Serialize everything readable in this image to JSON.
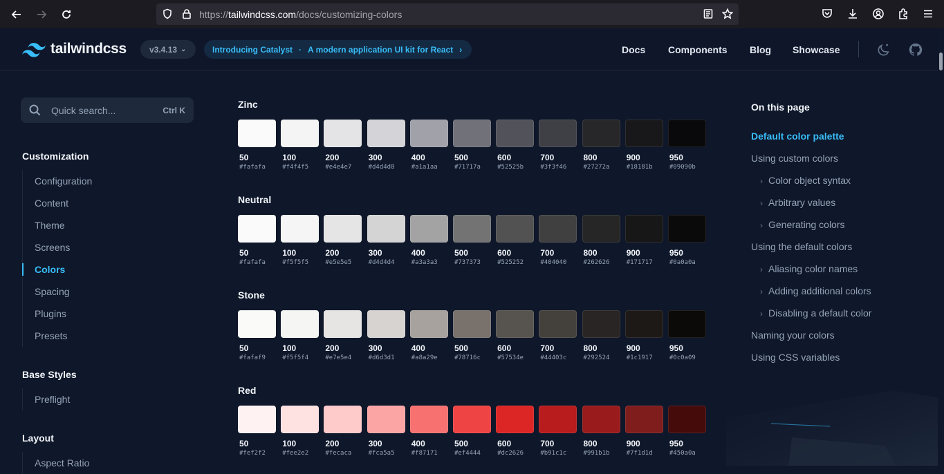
{
  "browser": {
    "url_prefix": "https://",
    "url_host": "tailwindcss.com",
    "url_path": "/docs/customizing-colors"
  },
  "header": {
    "logo_text": "tailwindcss",
    "version": "v3.4.13",
    "promo_title": "Introducing Catalyst",
    "promo_dot": "·",
    "promo_subtitle": "A modern application UI kit for React",
    "promo_arrow": "›",
    "nav": [
      "Docs",
      "Components",
      "Blog",
      "Showcase"
    ]
  },
  "sidebar": {
    "search_placeholder": "Quick search...",
    "search_shortcut": "Ctrl K",
    "sections": [
      {
        "title": "Customization",
        "items": [
          "Configuration",
          "Content",
          "Theme",
          "Screens",
          "Colors",
          "Spacing",
          "Plugins",
          "Presets"
        ],
        "active": "Colors"
      },
      {
        "title": "Base Styles",
        "items": [
          "Preflight"
        ]
      },
      {
        "title": "Layout",
        "items": [
          "Aspect Ratio"
        ]
      }
    ]
  },
  "palettes": [
    {
      "name": "Zinc",
      "swatches": [
        {
          "shade": "50",
          "hex": "#fafafa"
        },
        {
          "shade": "100",
          "hex": "#f4f4f5"
        },
        {
          "shade": "200",
          "hex": "#e4e4e7"
        },
        {
          "shade": "300",
          "hex": "#d4d4d8"
        },
        {
          "shade": "400",
          "hex": "#a1a1aa"
        },
        {
          "shade": "500",
          "hex": "#71717a"
        },
        {
          "shade": "600",
          "hex": "#52525b"
        },
        {
          "shade": "700",
          "hex": "#3f3f46"
        },
        {
          "shade": "800",
          "hex": "#27272a"
        },
        {
          "shade": "900",
          "hex": "#18181b"
        },
        {
          "shade": "950",
          "hex": "#09090b"
        }
      ]
    },
    {
      "name": "Neutral",
      "swatches": [
        {
          "shade": "50",
          "hex": "#fafafa"
        },
        {
          "shade": "100",
          "hex": "#f5f5f5"
        },
        {
          "shade": "200",
          "hex": "#e5e5e5"
        },
        {
          "shade": "300",
          "hex": "#d4d4d4"
        },
        {
          "shade": "400",
          "hex": "#a3a3a3"
        },
        {
          "shade": "500",
          "hex": "#737373"
        },
        {
          "shade": "600",
          "hex": "#525252"
        },
        {
          "shade": "700",
          "hex": "#404040"
        },
        {
          "shade": "800",
          "hex": "#262626"
        },
        {
          "shade": "900",
          "hex": "#171717"
        },
        {
          "shade": "950",
          "hex": "#0a0a0a"
        }
      ]
    },
    {
      "name": "Stone",
      "swatches": [
        {
          "shade": "50",
          "hex": "#fafaf9"
        },
        {
          "shade": "100",
          "hex": "#f5f5f4"
        },
        {
          "shade": "200",
          "hex": "#e7e5e4"
        },
        {
          "shade": "300",
          "hex": "#d6d3d1"
        },
        {
          "shade": "400",
          "hex": "#a8a29e"
        },
        {
          "shade": "500",
          "hex": "#78716c"
        },
        {
          "shade": "600",
          "hex": "#57534e"
        },
        {
          "shade": "700",
          "hex": "#44403c"
        },
        {
          "shade": "800",
          "hex": "#292524"
        },
        {
          "shade": "900",
          "hex": "#1c1917"
        },
        {
          "shade": "950",
          "hex": "#0c0a09"
        }
      ]
    },
    {
      "name": "Red",
      "swatches": [
        {
          "shade": "50",
          "hex": "#fef2f2"
        },
        {
          "shade": "100",
          "hex": "#fee2e2"
        },
        {
          "shade": "200",
          "hex": "#fecaca"
        },
        {
          "shade": "300",
          "hex": "#fca5a5"
        },
        {
          "shade": "400",
          "hex": "#f87171"
        },
        {
          "shade": "500",
          "hex": "#ef4444"
        },
        {
          "shade": "600",
          "hex": "#dc2626"
        },
        {
          "shade": "700",
          "hex": "#b91c1c"
        },
        {
          "shade": "800",
          "hex": "#991b1b"
        },
        {
          "shade": "900",
          "hex": "#7f1d1d"
        },
        {
          "shade": "950",
          "hex": "#450a0a"
        }
      ]
    }
  ],
  "toc": {
    "title": "On this page",
    "items": [
      {
        "label": "Default color palette",
        "level": 1,
        "active": true
      },
      {
        "label": "Using custom colors",
        "level": 1
      },
      {
        "label": "Color object syntax",
        "level": 2
      },
      {
        "label": "Arbitrary values",
        "level": 2
      },
      {
        "label": "Generating colors",
        "level": 2
      },
      {
        "label": "Using the default colors",
        "level": 1
      },
      {
        "label": "Aliasing color names",
        "level": 2
      },
      {
        "label": "Adding additional colors",
        "level": 2
      },
      {
        "label": "Disabling a default color",
        "level": 2
      },
      {
        "label": "Naming your colors",
        "level": 1
      },
      {
        "label": "Using CSS variables",
        "level": 1
      }
    ]
  },
  "colors": {
    "accent": "#38bdf8",
    "background": "#0f172a"
  }
}
